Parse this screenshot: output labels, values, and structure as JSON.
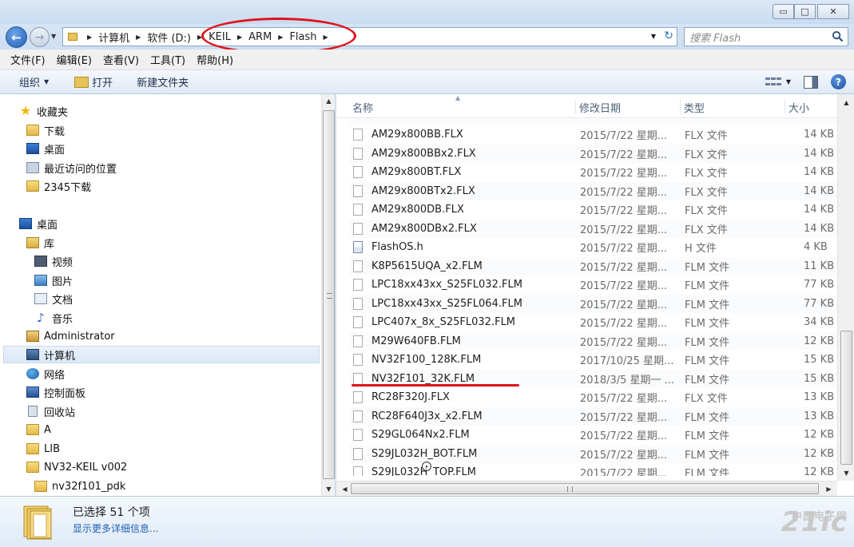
{
  "window": {
    "minimize_glyph": "▭",
    "maximize_glyph": "□",
    "close_glyph": "✕"
  },
  "address": {
    "crumbs": [
      "计算机",
      "软件 (D:)",
      "KEIL",
      "ARM",
      "Flash"
    ],
    "back_glyph": "←",
    "forward_glyph": "→"
  },
  "search": {
    "placeholder": "搜索 Flash"
  },
  "menu": [
    "文件(F)",
    "编辑(E)",
    "查看(V)",
    "工具(T)",
    "帮助(H)"
  ],
  "toolbar": {
    "organize": "组织",
    "open": "打开",
    "new_folder": "新建文件夹"
  },
  "nav": {
    "items": [
      {
        "label": "收藏夹",
        "icon": "star-icon"
      },
      {
        "label": "下载",
        "icon": "download-folder-icon"
      },
      {
        "label": "桌面",
        "icon": "desktop-icon"
      },
      {
        "label": "最近访问的位置",
        "icon": "recent-places-icon"
      },
      {
        "label": "2345下载",
        "icon": "folder-icon"
      },
      {
        "label": "桌面",
        "icon": "desktop-icon"
      },
      {
        "label": "库",
        "icon": "library-icon"
      },
      {
        "label": "视频",
        "icon": "video-icon"
      },
      {
        "label": "图片",
        "icon": "pictures-icon"
      },
      {
        "label": "文档",
        "icon": "documents-icon"
      },
      {
        "label": "音乐",
        "icon": "music-icon"
      },
      {
        "label": "Administrator",
        "icon": "user-folder-icon"
      },
      {
        "label": "计算机",
        "icon": "computer-icon"
      },
      {
        "label": "网络",
        "icon": "network-icon"
      },
      {
        "label": "控制面板",
        "icon": "control-panel-icon"
      },
      {
        "label": "回收站",
        "icon": "recycle-bin-icon"
      },
      {
        "label": "A",
        "icon": "folder-icon"
      },
      {
        "label": "LIB",
        "icon": "folder-icon"
      },
      {
        "label": "NV32-KEIL v002",
        "icon": "folder-icon"
      },
      {
        "label": "nv32f101_pdk",
        "icon": "folder-icon"
      }
    ]
  },
  "columns": {
    "name": "名称",
    "modified": "修改日期",
    "type": "类型",
    "size": "大小"
  },
  "files": [
    {
      "name": "AM29x800BB.FLX",
      "date": "2015/7/22 星期...",
      "type": "FLX 文件",
      "size": "14 KB",
      "icon": "file-icon"
    },
    {
      "name": "AM29x800BBx2.FLX",
      "date": "2015/7/22 星期...",
      "type": "FLX 文件",
      "size": "14 KB",
      "icon": "file-icon"
    },
    {
      "name": "AM29x800BT.FLX",
      "date": "2015/7/22 星期...",
      "type": "FLX 文件",
      "size": "14 KB",
      "icon": "file-icon"
    },
    {
      "name": "AM29x800BTx2.FLX",
      "date": "2015/7/22 星期...",
      "type": "FLX 文件",
      "size": "14 KB",
      "icon": "file-icon"
    },
    {
      "name": "AM29x800DB.FLX",
      "date": "2015/7/22 星期...",
      "type": "FLX 文件",
      "size": "14 KB",
      "icon": "file-icon"
    },
    {
      "name": "AM29x800DBx2.FLX",
      "date": "2015/7/22 星期...",
      "type": "FLX 文件",
      "size": "14 KB",
      "icon": "file-icon"
    },
    {
      "name": "FlashOS.h",
      "date": "2015/7/22 星期...",
      "type": "H 文件",
      "size": "4 KB",
      "icon": "h-file-icon"
    },
    {
      "name": "K8P5615UQA_x2.FLM",
      "date": "2015/7/22 星期...",
      "type": "FLM 文件",
      "size": "11 KB",
      "icon": "file-icon"
    },
    {
      "name": "LPC18xx43xx_S25FL032.FLM",
      "date": "2015/7/22 星期...",
      "type": "FLM 文件",
      "size": "77 KB",
      "icon": "file-icon"
    },
    {
      "name": "LPC18xx43xx_S25FL064.FLM",
      "date": "2015/7/22 星期...",
      "type": "FLM 文件",
      "size": "77 KB",
      "icon": "file-icon"
    },
    {
      "name": "LPC407x_8x_S25FL032.FLM",
      "date": "2015/7/22 星期...",
      "type": "FLM 文件",
      "size": "34 KB",
      "icon": "file-icon"
    },
    {
      "name": "M29W640FB.FLM",
      "date": "2015/7/22 星期...",
      "type": "FLM 文件",
      "size": "12 KB",
      "icon": "file-icon"
    },
    {
      "name": "NV32F100_128K.FLM",
      "date": "2017/10/25 星期...",
      "type": "FLM 文件",
      "size": "15 KB",
      "icon": "file-icon"
    },
    {
      "name": "NV32F101_32K.FLM",
      "date": "2018/3/5 星期一 ...",
      "type": "FLM 文件",
      "size": "15 KB",
      "icon": "file-icon"
    },
    {
      "name": "RC28F320J.FLX",
      "date": "2015/7/22 星期...",
      "type": "FLX 文件",
      "size": "13 KB",
      "icon": "file-icon"
    },
    {
      "name": "RC28F640J3x_x2.FLM",
      "date": "2015/7/22 星期...",
      "type": "FLM 文件",
      "size": "13 KB",
      "icon": "file-icon"
    },
    {
      "name": "S29GL064Nx2.FLM",
      "date": "2015/7/22 星期...",
      "type": "FLM 文件",
      "size": "12 KB",
      "icon": "file-icon"
    },
    {
      "name": "S29JL032H_BOT.FLM",
      "date": "2015/7/22 星期...",
      "type": "FLM 文件",
      "size": "12 KB",
      "icon": "file-icon"
    },
    {
      "name": "S29JL032H_TOP.FLM",
      "date": "2015/7/22 星期...",
      "type": "FLM 文件",
      "size": "12 KB",
      "icon": "file-icon"
    }
  ],
  "details": {
    "title": "已选择 51 个项",
    "link": "显示更多详细信息..."
  },
  "watermark": {
    "text": "21ic",
    "sub": "中国电子网"
  },
  "colors": {
    "highlight_red": "#e0141b",
    "link_blue": "#1f5fb4"
  }
}
